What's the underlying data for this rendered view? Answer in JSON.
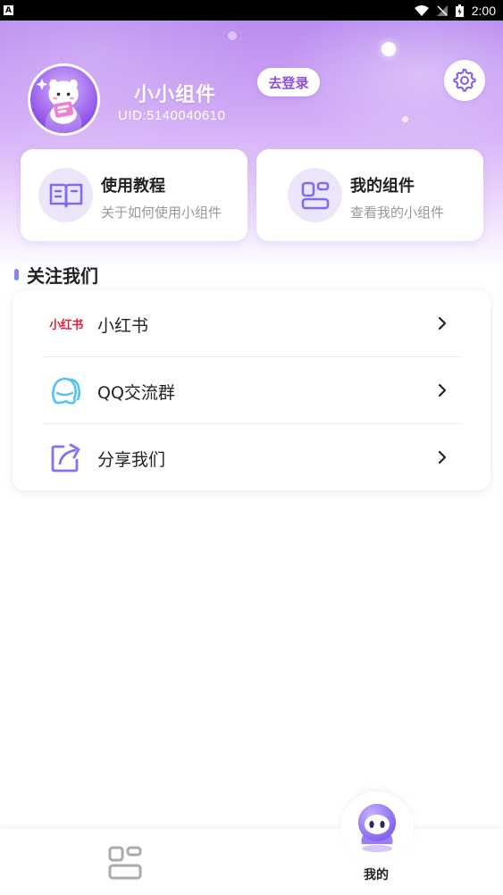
{
  "status_bar": {
    "time": "2:00",
    "notification": "A"
  },
  "header": {
    "username": "小小组件",
    "uid": "UID:5140040610",
    "login_label": "去登录"
  },
  "cards": [
    {
      "title": "使用教程",
      "subtitle": "关于如何使用小组件",
      "icon": "book-icon"
    },
    {
      "title": "我的组件",
      "subtitle": "查看我的小组件",
      "icon": "widgets-icon"
    }
  ],
  "section": {
    "title": "关注我们"
  },
  "list": [
    {
      "label": "小红书",
      "icon": "xiaohongshu-logo",
      "logo_text": "小红书"
    },
    {
      "label": "QQ交流群",
      "icon": "qq-icon"
    },
    {
      "label": "分享我们",
      "icon": "share-icon"
    }
  ],
  "bottom_nav": {
    "items": [
      {
        "label": "",
        "icon": "widgets-icon",
        "active": false
      },
      {
        "label": "我的",
        "icon": "robot-avatar-icon",
        "active": true
      }
    ]
  },
  "colors": {
    "accent": "#8a4fe0",
    "icon_purple": "#7b6cf0",
    "qq_blue": "#56c2f2",
    "xhs_red": "#e2203a"
  }
}
